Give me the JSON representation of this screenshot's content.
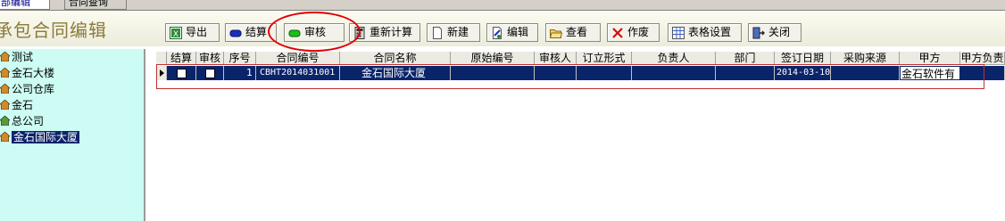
{
  "tabs": [
    {
      "label": "部编辑",
      "active": true
    },
    {
      "label": "合同查询",
      "active": false
    }
  ],
  "window_title": "承包合同编辑",
  "toolbar": [
    {
      "id": "export",
      "label": "导出",
      "icon": "excel-icon"
    },
    {
      "id": "settle",
      "label": "结算",
      "icon": "blue-pill-icon"
    },
    {
      "id": "audit",
      "label": "审核",
      "icon": "green-pill-icon"
    },
    {
      "id": "recalc",
      "label": "重新计算",
      "icon": "calculator-icon"
    },
    {
      "id": "new",
      "label": "新建",
      "icon": "new-document-icon"
    },
    {
      "id": "edit",
      "label": "编辑",
      "icon": "edit-document-icon"
    },
    {
      "id": "view",
      "label": "查看",
      "icon": "folder-open-icon"
    },
    {
      "id": "void",
      "label": "作废",
      "icon": "red-x-icon"
    },
    {
      "id": "table_settings",
      "label": "表格设置",
      "icon": "table-icon"
    },
    {
      "id": "close",
      "label": "关闭",
      "icon": "exit-door-icon"
    }
  ],
  "tree": {
    "items": [
      "测试",
      "金石大楼",
      "公司仓库",
      "金石",
      "总公司",
      "金石国际大厦"
    ],
    "selected_index": 5
  },
  "grid": {
    "columns": [
      "结算",
      "审核",
      "序号",
      "合同编号",
      "合同名称",
      "原始编号",
      "审核人",
      "订立形式",
      "负责人",
      "部门",
      "签订日期",
      "采购来源",
      "甲方",
      "甲方负责"
    ],
    "rows": [
      {
        "settle": false,
        "audit": false,
        "seq": "1",
        "contract_no": "CBHT2014031001",
        "contract_name": "金石国际大厦",
        "orig_no": "",
        "auditor": "",
        "form": "",
        "owner": "",
        "dept": "",
        "sign_date": "2014-03-10",
        "source": "",
        "party_a": "金石软件有",
        "party_a_owner": ""
      }
    ]
  },
  "colors": {
    "accent_red": "#e00000",
    "selection": "#0a246a",
    "tree_bg": "#ccfcf4",
    "title": "#8b7a3a"
  }
}
